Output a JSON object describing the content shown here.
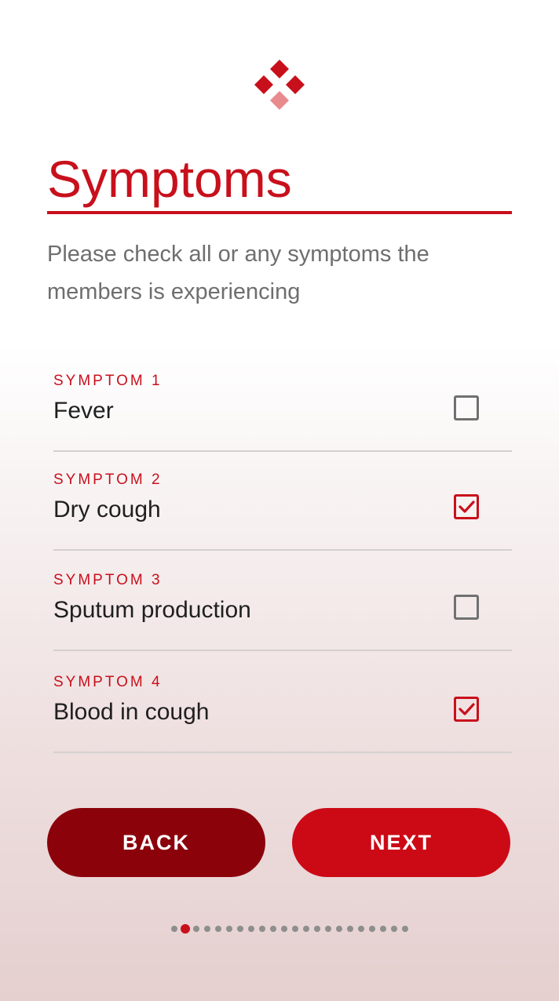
{
  "header": {
    "logo_icon": "diamond-cluster-logo",
    "title": "Symptoms",
    "subtitle": "Please check all or any symptoms the members is experiencing"
  },
  "symptoms": [
    {
      "tag": "SYMPTOM 1",
      "name": "Fever",
      "checked": false
    },
    {
      "tag": "SYMPTOM 2",
      "name": "Dry cough",
      "checked": true
    },
    {
      "tag": "SYMPTOM 3",
      "name": "Sputum production",
      "checked": false
    },
    {
      "tag": "SYMPTOM 4",
      "name": "Blood in cough",
      "checked": true
    }
  ],
  "actions": {
    "back_label": "BACK",
    "next_label": "NEXT"
  },
  "pagination": {
    "total_steps": 22,
    "current_step": 2
  },
  "colors": {
    "accent": "#c8101c",
    "back_button": "#8b020b",
    "next_button": "#cc0a16",
    "logo_light": "#e88a8e"
  }
}
